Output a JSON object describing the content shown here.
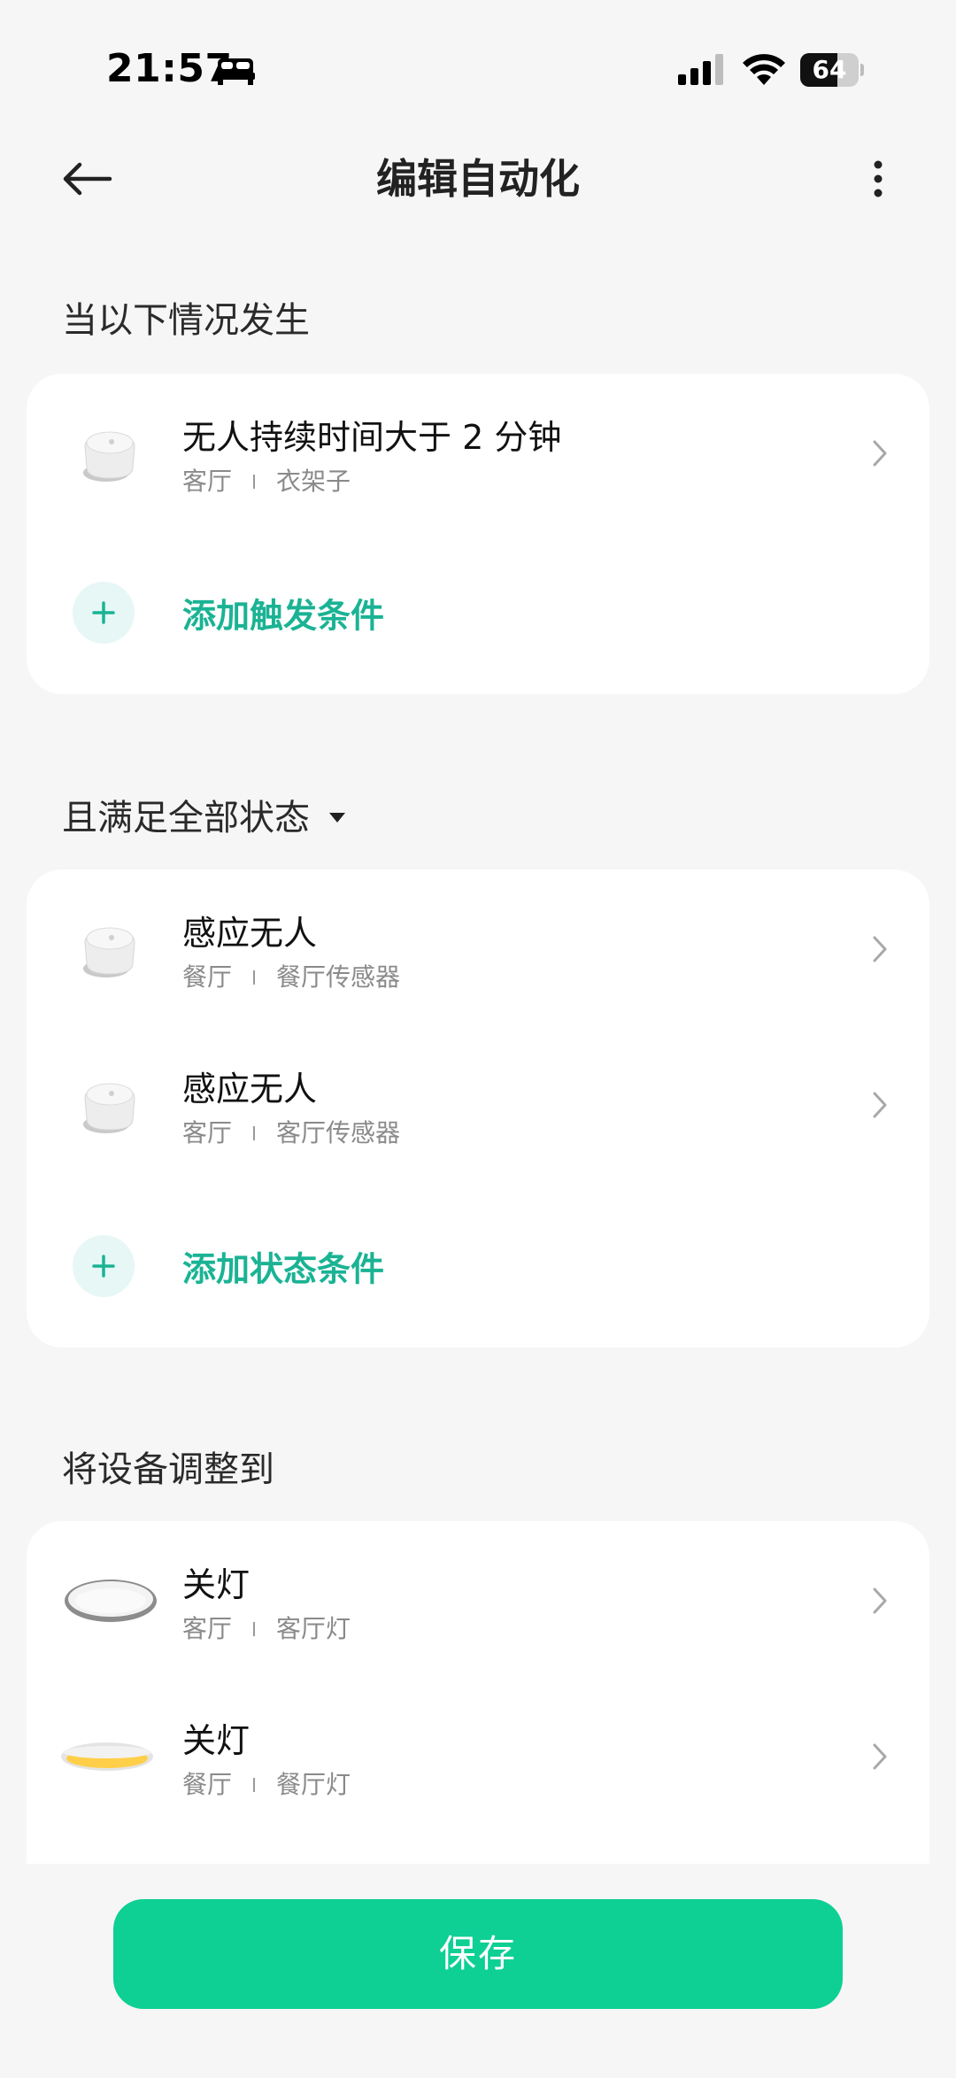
{
  "status_bar": {
    "time": "21:57",
    "battery_level": "64",
    "battery_fraction": 0.64
  },
  "header": {
    "title": "编辑自动化",
    "back_icon": "arrow-left-icon",
    "more_icon": "more-vertical-icon"
  },
  "trigger_section": {
    "title": "当以下情况发生",
    "items": [
      {
        "title": "无人持续时间大于 2 分钟",
        "room": "客厅",
        "device": "衣架子",
        "icon": "sensor-icon"
      }
    ],
    "add_label": "添加触发条件"
  },
  "condition_section": {
    "title": "且满足全部状态",
    "items": [
      {
        "title": "感应无人",
        "room": "餐厅",
        "device": "餐厅传感器",
        "icon": "sensor-icon"
      },
      {
        "title": "感应无人",
        "room": "客厅",
        "device": "客厅传感器",
        "icon": "sensor-icon"
      }
    ],
    "add_label": "添加状态条件"
  },
  "action_section": {
    "title": "将设备调整到",
    "items": [
      {
        "title": "关灯",
        "room": "客厅",
        "device": "客厅灯",
        "icon": "ceiling-light-icon"
      },
      {
        "title": "关灯",
        "room": "餐厅",
        "device": "餐厅灯",
        "icon": "ceiling-light-warm-icon"
      }
    ]
  },
  "footer": {
    "save_label": "保存"
  },
  "colors": {
    "accent": "#1ab394",
    "save_button": "#0ecf94",
    "background": "#f6f6f6"
  }
}
